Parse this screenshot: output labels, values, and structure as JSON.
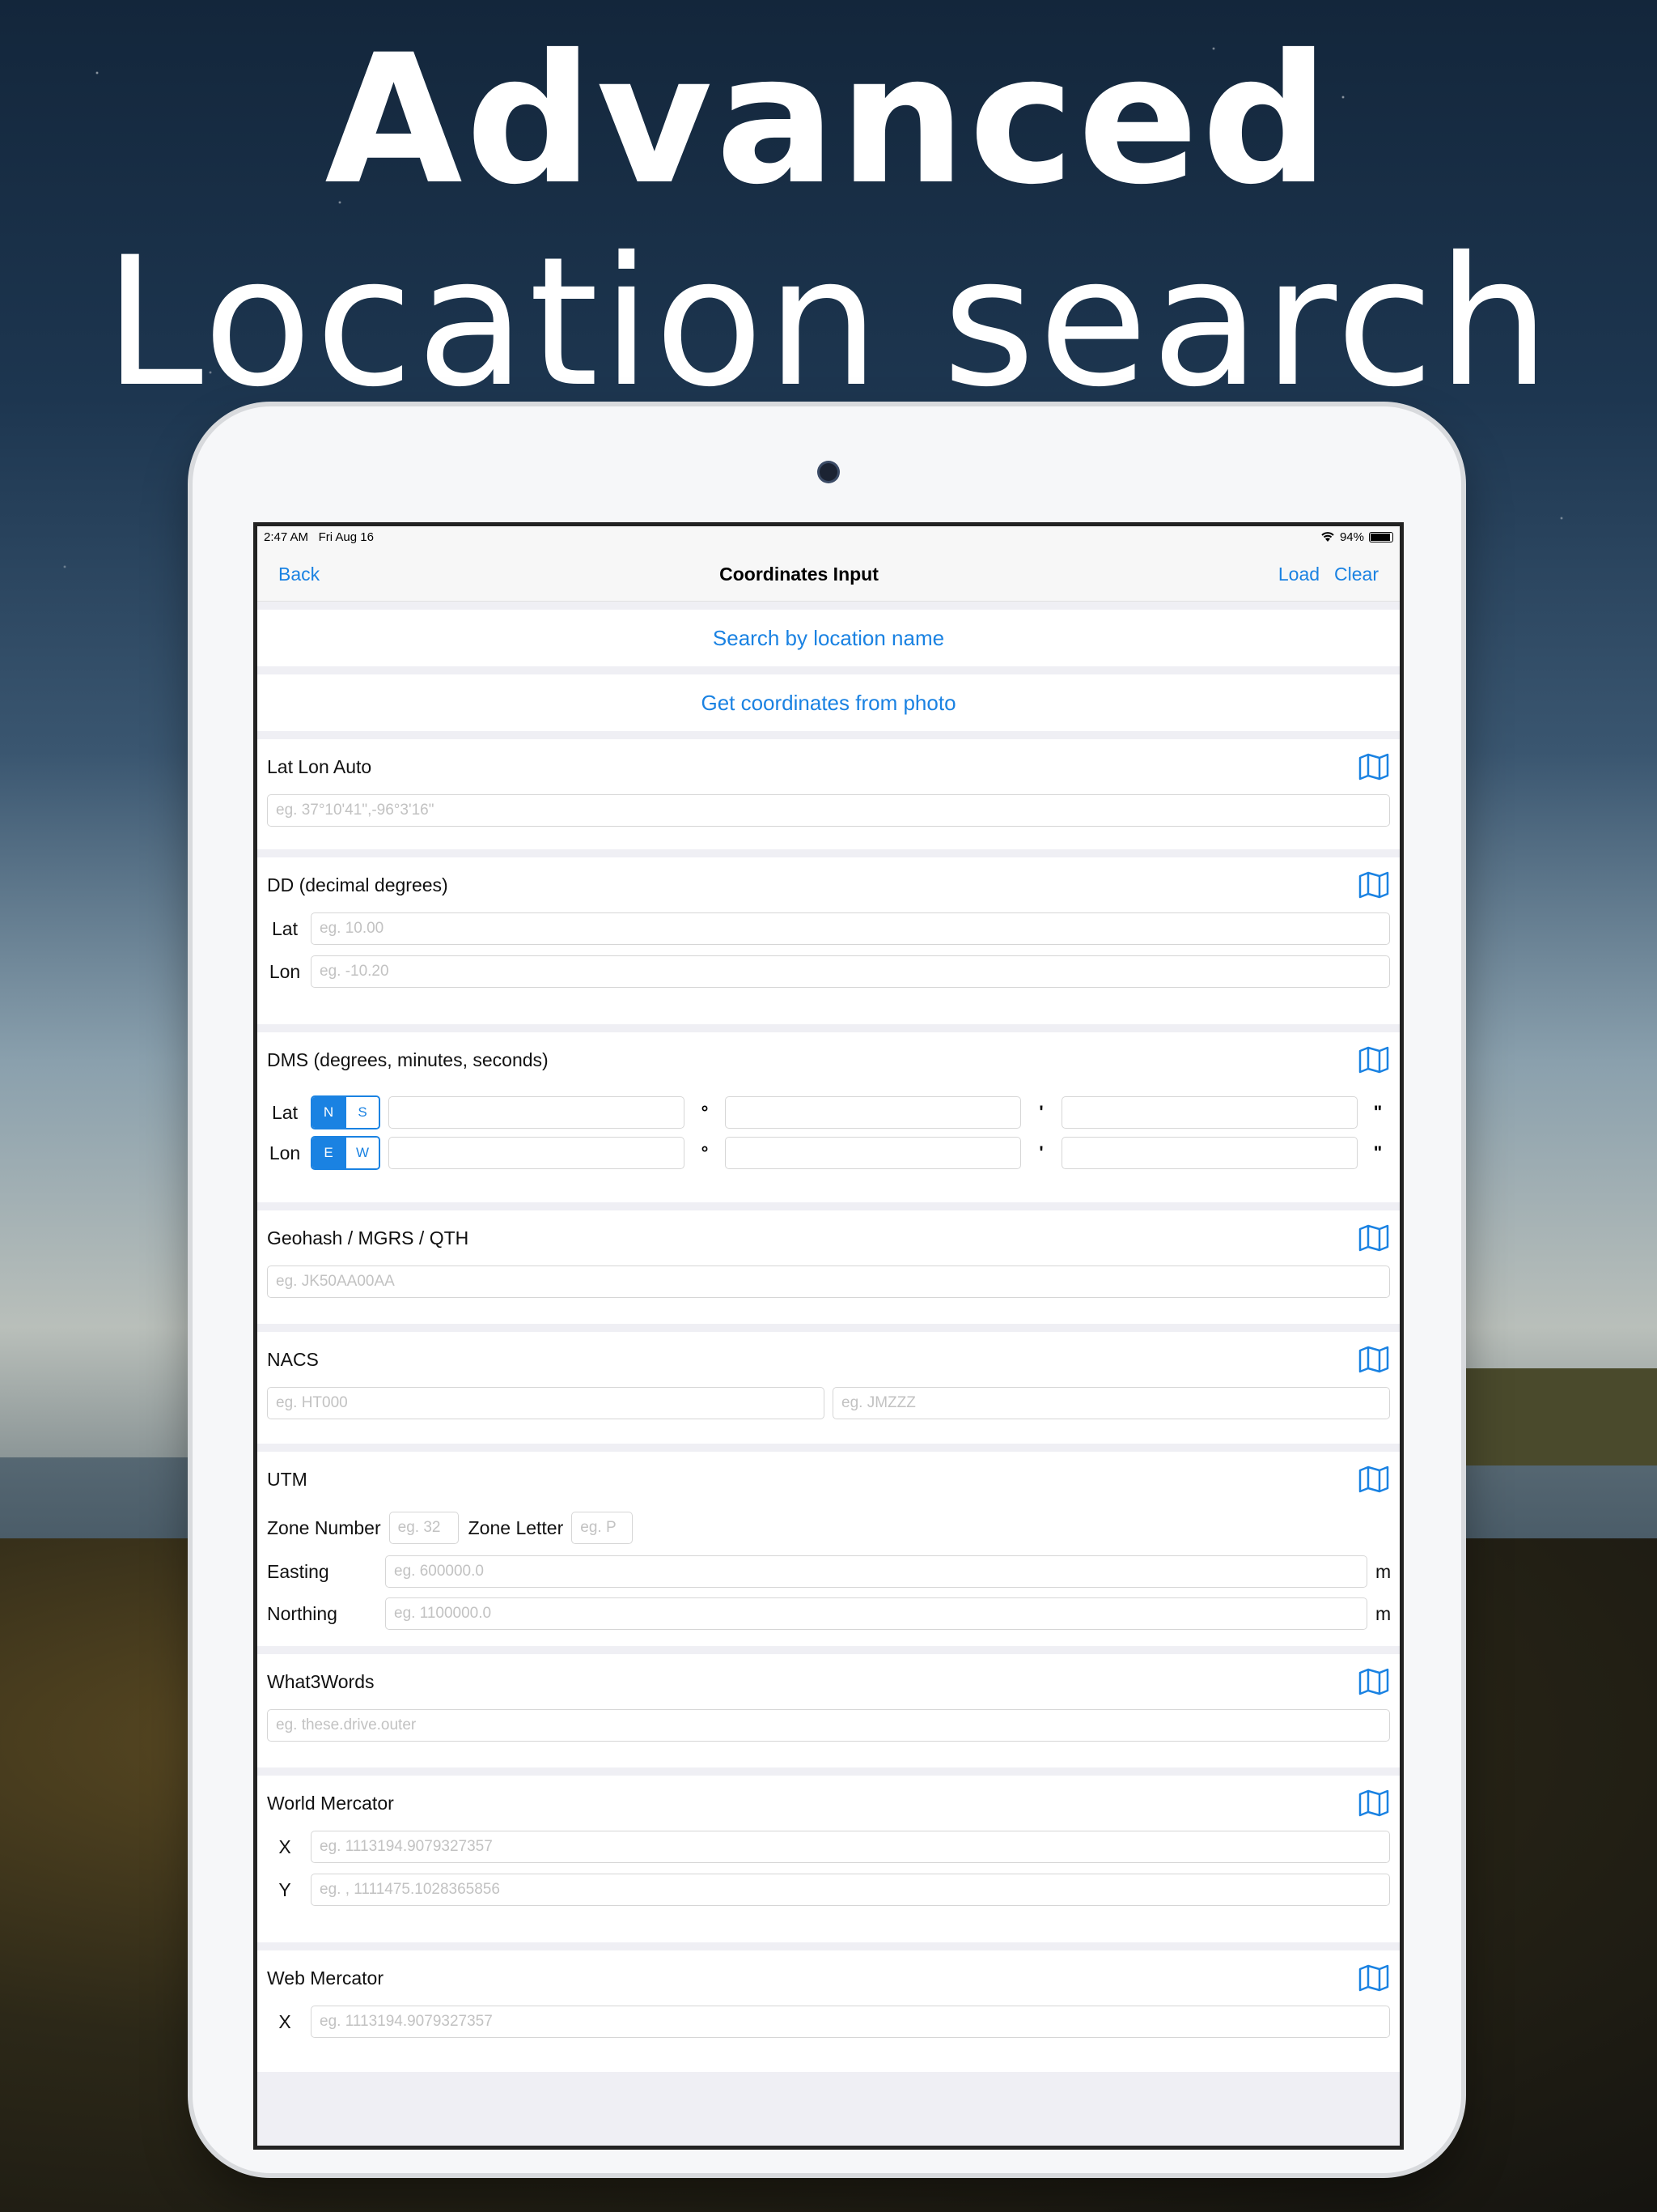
{
  "headline": {
    "line1": "Advanced",
    "line2": "Location search"
  },
  "status": {
    "time": "2:47 AM",
    "date": "Fri Aug 16",
    "battery": "94%"
  },
  "nav": {
    "back": "Back",
    "title": "Coordinates Input",
    "load": "Load",
    "clear": "Clear"
  },
  "actions": {
    "search_by_name": "Search by location name",
    "from_photo": "Get coordinates from photo"
  },
  "latlon": {
    "title": "Lat Lon Auto",
    "placeholder": "eg. 37°10'41\",-96°3'16\""
  },
  "dd": {
    "title": "DD (decimal degrees)",
    "lat_label": "Lat",
    "lat_placeholder": "eg. 10.00",
    "lon_label": "Lon",
    "lon_placeholder": "eg. -10.20"
  },
  "dms": {
    "title": "DMS (degrees, minutes, seconds)",
    "lat_label": "Lat",
    "lat_opts": [
      "N",
      "S"
    ],
    "lon_label": "Lon",
    "lon_opts": [
      "E",
      "W"
    ],
    "deg": "°",
    "min": "'",
    "sec": "\""
  },
  "geohash": {
    "title": "Geohash / MGRS / QTH",
    "placeholder": "eg. JK50AA00AA"
  },
  "nacs": {
    "title": "NACS",
    "placeholder1": "eg. HT000",
    "placeholder2": "eg. JMZZZ"
  },
  "utm": {
    "title": "UTM",
    "zone_number": "Zone Number",
    "zone_number_ph": "eg. 32",
    "zone_letter": "Zone Letter",
    "zone_letter_ph": "eg. P",
    "easting": "Easting",
    "easting_ph": "eg. 600000.0",
    "northing": "Northing",
    "northing_ph": "eg. 1100000.0",
    "unit": "m"
  },
  "w3w": {
    "title": "What3Words",
    "placeholder": "eg. these.drive.outer"
  },
  "world_merc": {
    "title": "World Mercator",
    "x": "X",
    "x_ph": "eg. 1113194.9079327357",
    "y": "Y",
    "y_ph": "eg. , 1111475.1028365856"
  },
  "web_merc": {
    "title": "Web Mercator",
    "x": "X",
    "x_ph": "eg. 1113194.9079327357"
  }
}
